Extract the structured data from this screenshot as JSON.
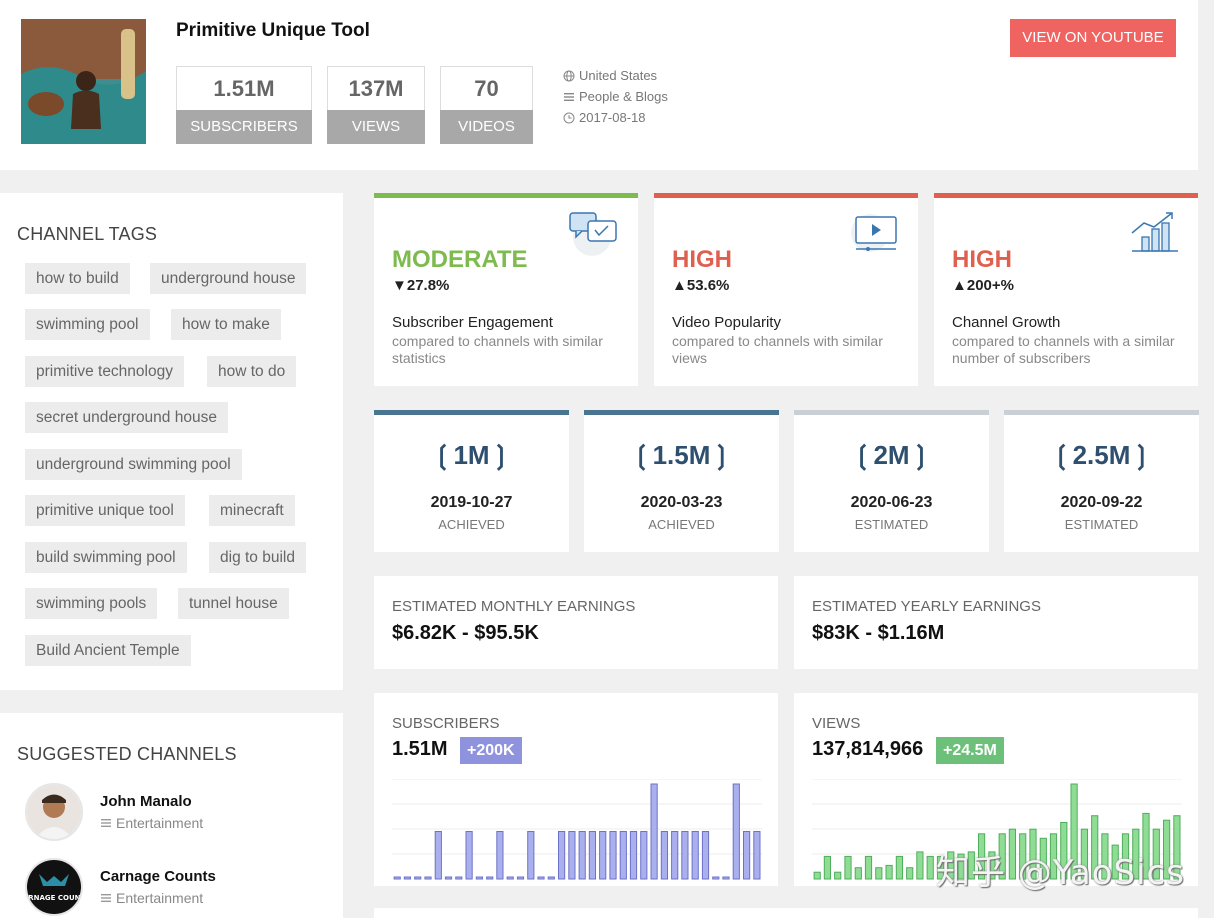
{
  "channel": {
    "title": "Primitive Unique Tool",
    "stats": [
      {
        "value": "1.51M",
        "label": "SUBSCRIBERS"
      },
      {
        "value": "137M",
        "label": "VIEWS"
      },
      {
        "value": "70",
        "label": "VIDEOS"
      }
    ],
    "country": "United States",
    "category": "People & Blogs",
    "created": "2017-08-18",
    "youtube_button": "VIEW ON YOUTUBE"
  },
  "tags": {
    "title": "CHANNEL TAGS",
    "items": [
      "how to build",
      "underground house",
      "swimming pool",
      "how to make",
      "primitive technology",
      "how to do",
      "secret underground house",
      "underground swimming pool",
      "primitive unique tool",
      "minecraft",
      "build swimming pool",
      "dig to build",
      "swimming pools",
      "tunnel house",
      "Build Ancient Temple"
    ]
  },
  "suggested": {
    "title": "SUGGESTED CHANNELS",
    "items": [
      {
        "name": "John Manalo",
        "category": "Entertainment"
      },
      {
        "name": "Carnage Counts",
        "category": "Entertainment",
        "avatar_text": "CARNAGE COUNTS"
      }
    ]
  },
  "ratings": [
    {
      "level": "MODERATE",
      "change": "▼27.8%",
      "caption": "Subscriber Engagement",
      "sub": "compared to channels with similar statistics",
      "color": "#7dbb4f",
      "icon": "chat-bubbles-icon"
    },
    {
      "level": "HIGH",
      "change": "▲53.6%",
      "caption": "Video Popularity",
      "sub": "compared to channels with similar views",
      "color": "#e0604f",
      "icon": "video-screen-icon"
    },
    {
      "level": "HIGH",
      "change": "▲200+%",
      "caption": "Channel Growth",
      "sub": "compared to channels with a similar number of subscribers",
      "color": "#e0604f",
      "icon": "growth-chart-icon"
    }
  ],
  "milestones": [
    {
      "value": "1M",
      "date": "2019-10-27",
      "status": "ACHIEVED",
      "bar_color": "#4a7590"
    },
    {
      "value": "1.5M",
      "date": "2020-03-23",
      "status": "ACHIEVED",
      "bar_color": "#4a7590"
    },
    {
      "value": "2M",
      "date": "2020-06-23",
      "status": "ESTIMATED",
      "bar_color": "#c9cfd4"
    },
    {
      "value": "2.5M",
      "date": "2020-09-22",
      "status": "ESTIMATED",
      "bar_color": "#c9cfd4"
    }
  ],
  "earnings": {
    "monthly_title": "ESTIMATED MONTHLY EARNINGS",
    "monthly_value": "$6.82K - $95.5K",
    "yearly_title": "ESTIMATED YEARLY EARNINGS",
    "yearly_value": "$83K - $1.16M"
  },
  "charts": {
    "subscribers": {
      "title": "SUBSCRIBERS",
      "value": "1.51M",
      "delta": "+200K",
      "delta_color": "#8f93dd",
      "bar_color": "#aab0ee",
      "bar_stroke": "#6d72c9"
    },
    "views": {
      "title": "VIEWS",
      "value": "137,814,966",
      "delta": "+24.5M",
      "delta_color": "#6cc07a",
      "bar_color": "#8fdc95",
      "bar_stroke": "#4fae5a"
    }
  },
  "chart_data": [
    {
      "type": "bar",
      "series": [
        {
          "values": [
            0,
            0,
            0,
            0,
            20,
            0,
            0,
            20,
            0,
            0,
            20,
            0,
            0,
            20,
            0,
            0,
            20,
            20,
            20,
            20,
            20,
            20,
            20,
            20,
            20,
            40,
            20,
            20,
            20,
            20,
            20,
            0,
            0,
            40,
            20,
            20
          ]
        }
      ]
    },
    {
      "type": "bar",
      "series": [
        {
          "values": [
            3,
            10,
            3,
            10,
            5,
            10,
            5,
            6,
            10,
            5,
            12,
            10,
            10,
            12,
            11,
            12,
            20,
            12,
            20,
            22,
            20,
            22,
            18,
            20,
            25,
            42,
            22,
            28,
            20,
            15,
            20,
            22,
            29,
            22,
            26,
            28
          ]
        }
      ]
    }
  ],
  "watermark": "知乎 @YaoSics"
}
